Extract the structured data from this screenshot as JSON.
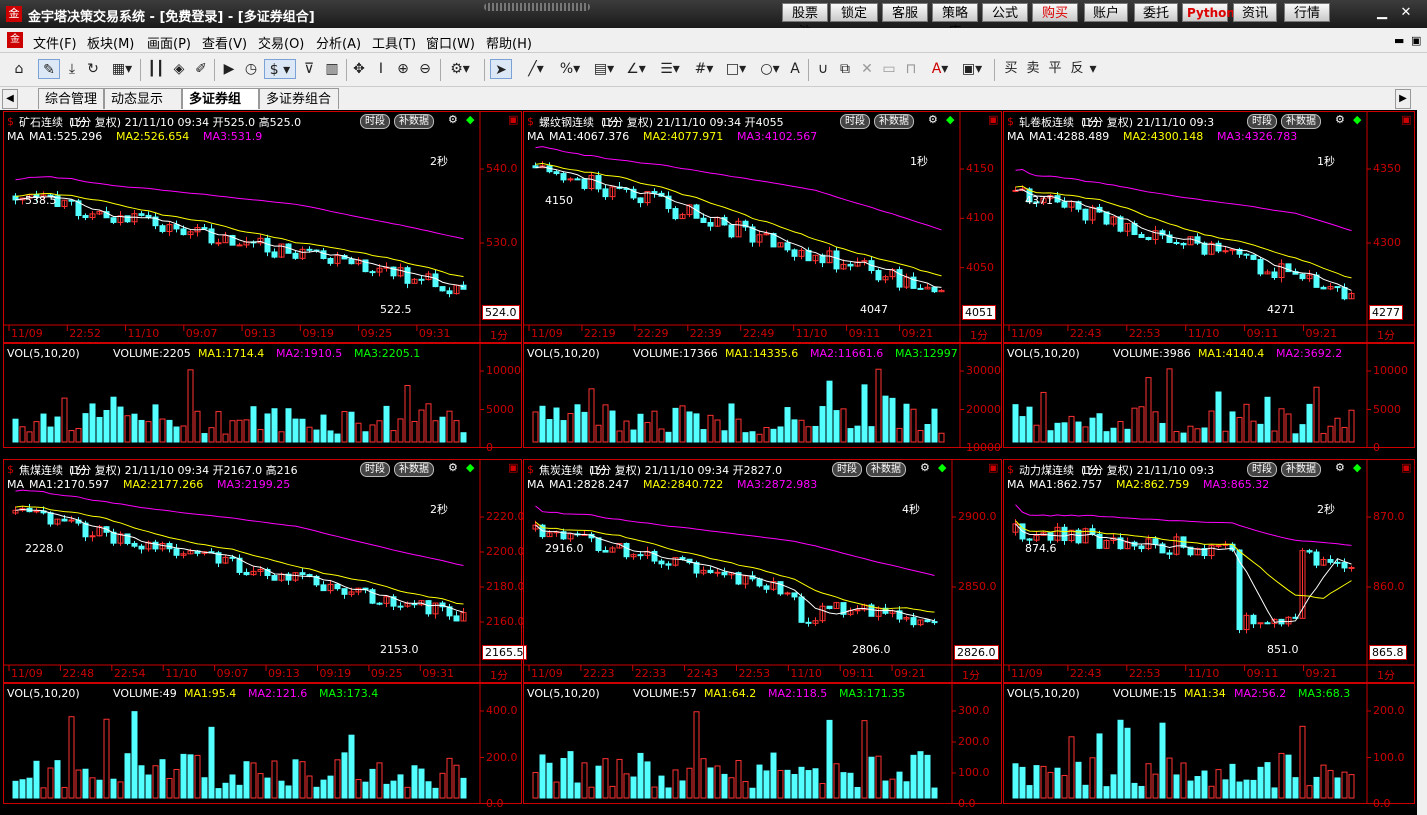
{
  "window": {
    "title": "金宇塔决策交易系统 - [免费登录] - [多证券组合]",
    "buttons": [
      "股票池",
      "锁定",
      "客服",
      "策略库",
      "公式",
      "购买",
      "账户",
      "委托",
      "Python",
      "资讯",
      "行情"
    ]
  },
  "menu": [
    "文件(F)",
    "板块(M)",
    "画面(P)",
    "查看(V)",
    "交易(O)",
    "分析(A)",
    "工具(T)",
    "窗口(W)",
    "帮助(H)"
  ],
  "tabs": [
    "综合管理",
    "动态显示牌",
    "多证券组合",
    "多证券组合"
  ],
  "toolbar_right": [
    "买",
    "卖",
    "平",
    "反"
  ],
  "panels": [
    {
      "name": "矿石连续",
      "period": "1分",
      "fq": "复权",
      "datetime": "21/11/10 09:34",
      "open": "开525.0",
      "high": "高525.0",
      "ma_line": {
        "prefix": "MA",
        "ma1": "MA1:525.296",
        "ma2": "MA2:526.654",
        "ma3": "MA3:531.9"
      },
      "refresh": "2秒",
      "hi_label": "538.5",
      "lo_label": "522.5",
      "price_tag": "524.0",
      "yaxis": [
        "540.0",
        "530.0"
      ],
      "xaxis": [
        "11/09",
        "22:52",
        "11/10",
        "09:07",
        "09:13",
        "09:19",
        "09:25",
        "09:31"
      ],
      "xunit": "1分",
      "vol": {
        "label": "VOL(5,10,20)",
        "volume": "VOLUME:2205",
        "ma1": "MA1:1714.4",
        "ma2": "MA2:1910.5",
        "ma3": "MA3:2205.1",
        "yaxis": [
          "10000",
          "5000",
          "0"
        ]
      }
    },
    {
      "name": "螺纹钢连续",
      "period": "1分",
      "fq": "复权",
      "datetime": "21/11/10 09:34",
      "open": "开4055",
      "ma_line": {
        "prefix": "MA",
        "ma1": "MA1:4067.376",
        "ma2": "MA2:4077.971",
        "ma3": "MA3:4102.567"
      },
      "refresh": "1秒",
      "hi_label": "4150",
      "lo_label": "4047",
      "price_tag": "4051",
      "yaxis": [
        "4150",
        "4100",
        "4050"
      ],
      "xaxis": [
        "11/09",
        "22:19",
        "22:29",
        "22:39",
        "22:49",
        "11/10",
        "09:11",
        "09:21"
      ],
      "xunit": "1分",
      "vol": {
        "label": "VOL(5,10,20)",
        "volume": "VOLUME:17366",
        "ma1": "MA1:14335.6",
        "ma2": "MA2:11661.6",
        "ma3": "MA3:12997",
        "yaxis": [
          "30000",
          "20000",
          "10000"
        ]
      }
    },
    {
      "name": "轧卷板连续",
      "period": "1分",
      "fq": "复权",
      "datetime": "21/11/10 09:3",
      "ma_line": {
        "prefix": "MA",
        "ma1": "MA1:4288.489",
        "ma2": "MA2:4300.148",
        "ma3": "MA3:4326.783"
      },
      "refresh": "1秒",
      "hi_label": "4371",
      "lo_label": "4271",
      "price_tag": "4277",
      "yaxis": [
        "4350",
        "4300"
      ],
      "xaxis": [
        "11/09",
        "22:43",
        "22:53",
        "11/10",
        "09:11",
        "09:21"
      ],
      "xunit": "1分",
      "vol": {
        "label": "VOL(5,10,20)",
        "volume": "VOLUME:3986",
        "ma1": "MA1:4140.4",
        "ma2": "MA2:3692.2",
        "yaxis": [
          "10000",
          "5000",
          "0"
        ]
      }
    },
    {
      "name": "焦煤连续",
      "period": "1分",
      "fq": "复权",
      "datetime": "21/11/10 09:34",
      "open": "开2167.0",
      "high": "高216",
      "ma_line": {
        "prefix": "MA",
        "ma1": "MA1:2170.597",
        "ma2": "MA2:2177.266",
        "ma3": "MA3:2199.25"
      },
      "refresh": "2秒",
      "hi_label": "2228.0",
      "lo_label": "2153.0",
      "price_tag": "2165.5",
      "yaxis": [
        "2220.0",
        "2200.0",
        "2180.0",
        "2160.0"
      ],
      "xaxis": [
        "11/09",
        "22:48",
        "22:54",
        "11/10",
        "09:07",
        "09:13",
        "09:19",
        "09:25",
        "09:31"
      ],
      "xunit": "1分",
      "vol": {
        "label": "VOL(5,10,20)",
        "volume": "VOLUME:49",
        "ma1": "MA1:95.4",
        "ma2": "MA2:121.6",
        "ma3": "MA3:173.4",
        "yaxis": [
          "400.0",
          "200.0",
          "0.0"
        ]
      }
    },
    {
      "name": "焦炭连续",
      "period": "1分",
      "fq": "复权",
      "datetime": "21/11/10 09:34",
      "open": "开2827.0",
      "ma_line": {
        "prefix": "MA",
        "ma1": "MA1:2828.247",
        "ma2": "MA2:2840.722",
        "ma3": "MA3:2872.983"
      },
      "refresh": "4秒",
      "hi_label": "2916.0",
      "lo_label": "2806.0",
      "price_tag": "2826.0",
      "yaxis": [
        "2900.0",
        "2850.0"
      ],
      "xaxis": [
        "11/09",
        "22:23",
        "22:33",
        "22:43",
        "22:53",
        "11/10",
        "09:11",
        "09:21"
      ],
      "xunit": "1分",
      "vol": {
        "label": "VOL(5,10,20)",
        "volume": "VOLUME:57",
        "ma1": "MA1:64.2",
        "ma2": "MA2:118.5",
        "ma3": "MA3:171.35",
        "yaxis": [
          "300.0",
          "200.0",
          "100.0",
          "0.0"
        ]
      }
    },
    {
      "name": "动力煤连续",
      "period": "1分",
      "fq": "复权",
      "datetime": "21/11/10 09:3",
      "ma_line": {
        "prefix": "MA",
        "ma1": "MA1:862.757",
        "ma2": "MA2:862.759",
        "ma3": "MA3:865.32"
      },
      "refresh": "2秒",
      "hi_label": "874.6",
      "lo_label": "851.0",
      "price_tag": "865.8",
      "yaxis": [
        "870.0",
        "860.0"
      ],
      "xaxis": [
        "11/09",
        "22:43",
        "22:53",
        "11/10",
        "09:11",
        "09:21"
      ],
      "xunit": "1分",
      "vol": {
        "label": "VOL(5,10,20)",
        "volume": "VOLUME:15",
        "ma1": "MA1:34",
        "ma2": "MA2:56.2",
        "ma3": "MA3:68.3",
        "yaxis": [
          "200.0",
          "100.0",
          "0.0"
        ]
      }
    }
  ],
  "panel_buttons": {
    "timeshare": "时段",
    "supplement": "补数据"
  },
  "colors": {
    "up": "#ff3232",
    "down": "#54ffff",
    "ma1": "#ffffff",
    "ma2": "#ffff00",
    "ma3": "#ff00ff",
    "axis": "#cc0000",
    "vol_ma3": "#00ff00"
  }
}
